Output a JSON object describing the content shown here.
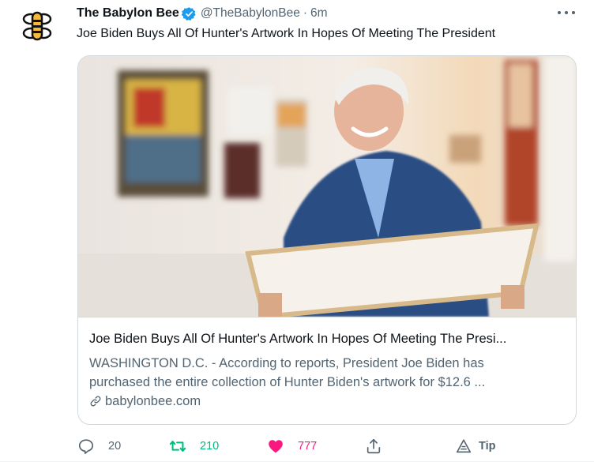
{
  "tweet": {
    "display_name": "The Babylon Bee",
    "handle": "@TheBabylonBee",
    "separator": "·",
    "time": "6m",
    "text": "Joe Biden Buys All Of Hunter's Artwork In Hopes Of Meeting The President"
  },
  "card": {
    "title": "Joe Biden Buys All Of Hunter's Artwork In Hopes Of Meeting The Presi...",
    "description_line1": "WASHINGTON D.C. - According to reports, President Joe Biden has",
    "description_line2": "purchased the entire collection of Hunter Biden's artwork for $12.6 ...",
    "domain": "babylonbee.com"
  },
  "actions": {
    "reply_count": "20",
    "retweet_count": "210",
    "like_count": "777",
    "tip_label": "Tip"
  },
  "icons": {
    "avatar": "bee-logo-icon",
    "verified": "verified-badge-icon",
    "more": "more-options-icon",
    "link": "link-icon",
    "reply": "reply-icon",
    "retweet": "retweet-icon",
    "like": "heart-icon",
    "share": "share-icon",
    "tip": "tip-icon"
  },
  "colors": {
    "verified_blue": "#1d9bf0",
    "retweet_green": "#00ba7c",
    "like_pink": "#f91880",
    "secondary_text": "#536471",
    "bee_yellow": "#f6b93b"
  }
}
